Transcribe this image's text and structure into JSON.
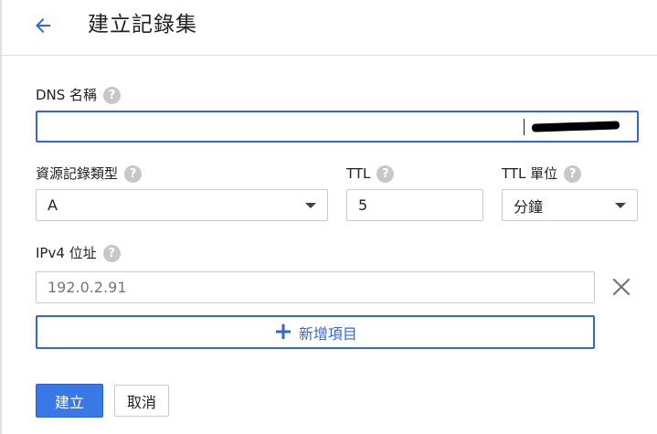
{
  "header": {
    "title": "建立記錄集",
    "back_icon": "arrow-back-icon"
  },
  "form": {
    "dns_name": {
      "label": "DNS 名稱",
      "value": ""
    },
    "record_type": {
      "label": "資源記錄類型",
      "value": "A"
    },
    "ttl": {
      "label": "TTL",
      "value": "5"
    },
    "ttl_unit": {
      "label": "TTL 單位",
      "value": "分鐘"
    },
    "ipv4": {
      "label": "IPv4 位址",
      "value": "192.0.2.91"
    },
    "add_item_label": "新增項目",
    "help_glyph": "?"
  },
  "actions": {
    "create_label": "建立",
    "cancel_label": "取消"
  },
  "colors": {
    "accent": "#3367d6",
    "primary_button": "#3b78e7",
    "help_icon": "#c7c7c7",
    "border": "#c9c9c9"
  }
}
